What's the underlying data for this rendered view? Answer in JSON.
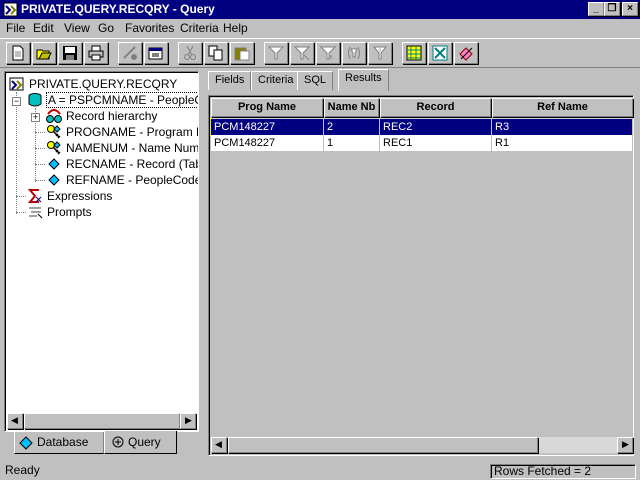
{
  "window": {
    "title": "PRIVATE.QUERY.RECQRY - Query",
    "minimize_label": "_",
    "restore_label": "❐",
    "close_label": "×"
  },
  "menu": [
    "File",
    "Edit",
    "View",
    "Go",
    "Favorites",
    "Criteria",
    "Help"
  ],
  "toolbar": {
    "buttons": [
      "new-icon",
      "open-icon",
      "save-icon",
      "print-icon",
      "run-icon",
      "properties-icon",
      "cut-icon",
      "copy-icon",
      "paste-icon",
      "add-criteria-icon",
      "delete-criteria-icon",
      "expression-icon",
      "having-icon",
      "prompt-icon",
      "grid-icon",
      "crystal-icon",
      "clear-icon"
    ]
  },
  "tree": {
    "root": "PRIVATE.QUERY.RECQRY",
    "record": "A = PSPCMNAME - PeopleCode",
    "hierarchy": "Record hierarchy",
    "fields": [
      "PROGNAME - Program Na",
      "NAMENUM - Name Numbe",
      "RECNAME - Record (Table",
      "REFNAME - PeopleCode F"
    ],
    "expressions": "Expressions",
    "prompts": "Prompts",
    "expander_minus": "−",
    "expander_plus": "+",
    "scroll_left": "◀",
    "scroll_right": "▶"
  },
  "left_tabs": {
    "database": "Database",
    "query": "Query",
    "active": "Query"
  },
  "right_tabs": {
    "items": [
      "Fields",
      "Criteria",
      "SQL",
      "Results"
    ],
    "active": "Results"
  },
  "results": {
    "columns": [
      "Prog Name",
      "Name Nb",
      "Record",
      "Ref Name"
    ],
    "rows": [
      [
        "PCM148227",
        "2",
        "REC2",
        "R3"
      ],
      [
        "PCM148227",
        "1",
        "REC1",
        "R1"
      ]
    ],
    "selected_row": 0,
    "scroll_left": "◀",
    "scroll_right": "▶"
  },
  "status": {
    "message": "Ready",
    "rows_fetched": "Rows Fetched = 2"
  },
  "colors": {
    "selection": "#000080",
    "title_bar": "#000080",
    "face": "#c0c0c0"
  }
}
